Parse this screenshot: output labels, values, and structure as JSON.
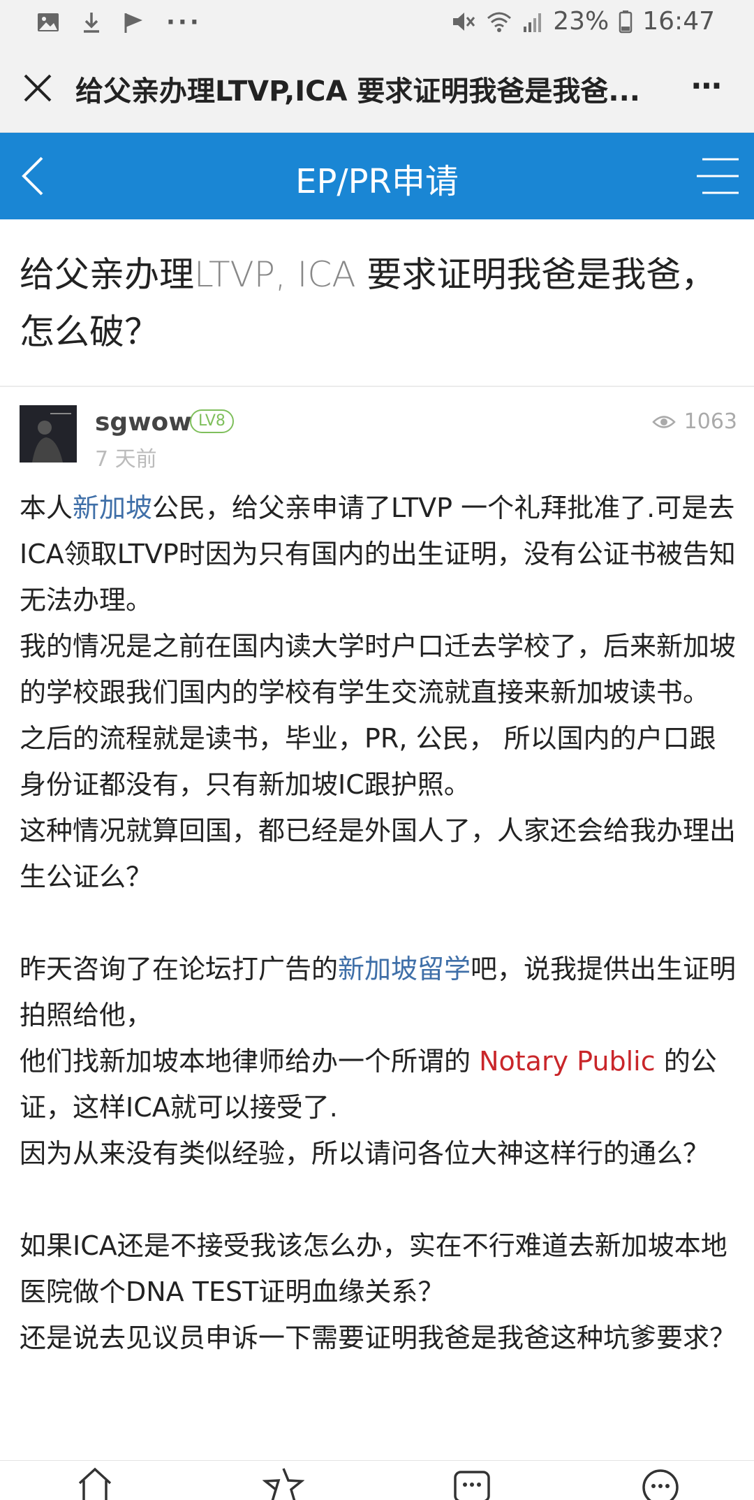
{
  "status_bar": {
    "battery": "23%",
    "time": "16:47",
    "overflow": "···"
  },
  "browser": {
    "title": "给父亲办理LTVP,ICA 要求证明我爸是我爸...",
    "more": "⋯"
  },
  "header": {
    "title": "EP/PR申请"
  },
  "thread": {
    "title_part1": "给父亲办理",
    "title_part2": "LTVP, ICA",
    "title_part3": " 要求证明我爸是我爸，怎么破？"
  },
  "author": {
    "name": "sgwow",
    "level": "LV8",
    "time": "7 天前",
    "views": "1063"
  },
  "post": {
    "p1_a": "本人",
    "p1_link": "新加坡",
    "p1_b": "公民，给父亲申请了LTVP 一个礼拜批准了.可是去ICA领取LTVP时因为只有国内的出生证明，没有公证书被告知无法办理。",
    "p2": "我的情况是之前在国内读大学时户口迁去学校了，后来新加坡的学校跟我们国内的学校有学生交流就直接来新加坡读书。",
    "p3": "之后的流程就是读书，毕业，PR, 公民， 所以国内的户口跟身份证都没有，只有新加坡IC跟护照。",
    "p4": "这种情况就算回国，都已经是外国人了，人家还会给我办理出生公证么？",
    "p5_a": "昨天咨询了在论坛打广告的",
    "p5_link": "新加坡留学",
    "p5_b": "吧，说我提供出生证明拍照给他，",
    "p6_a": "他们找新加坡本地律师给办一个所谓的 ",
    "p6_red": "Notary Public",
    "p6_b": " 的公证，这样ICA就可以接受了.",
    "p7": "因为从来没有类似经验，所以请问各位大神这样行的通么？",
    "p8": "如果ICA还是不接受我该怎么办，实在不行难道去新加坡本地医院做个DNA TEST证明血缘关系？",
    "p9": "还是说去见议员申诉一下需要证明我爸是我爸这种坑爹要求？"
  },
  "icons": {
    "status_left": [
      "image-icon",
      "download-icon",
      "flag-icon"
    ],
    "status_right": [
      "mute-icon",
      "wifi-icon",
      "signal-icon",
      "battery-icon"
    ],
    "bottom": [
      "home-icon",
      "star-icon",
      "comment-icon",
      "more-icon"
    ]
  },
  "colors": {
    "header_blue": "#1a86d4",
    "link_blue": "#3f6fa8",
    "notary_red": "#c9262a",
    "level_green": "#7fbf5c"
  }
}
